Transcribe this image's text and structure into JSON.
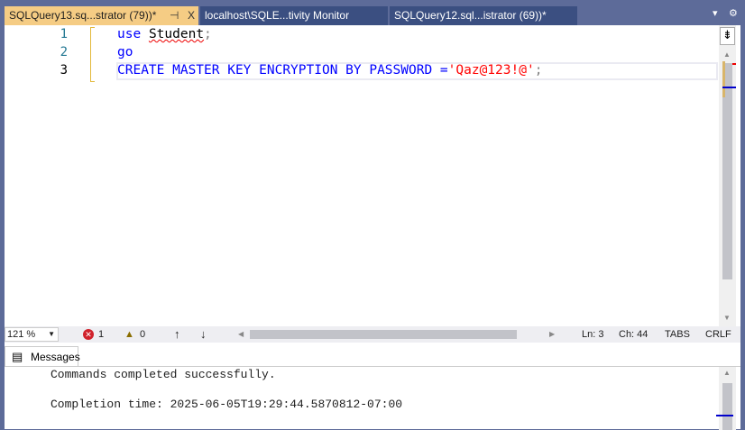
{
  "tabs": [
    {
      "label": "SQLQuery13.sq...strator (79))*",
      "active": true
    },
    {
      "label": "localhost\\SQLE...tivity Monitor",
      "active": false
    },
    {
      "label": "SQLQuery12.sql...istrator (69))*",
      "active": false
    }
  ],
  "tab_icons": {
    "pin": "⊣",
    "close": "X",
    "dropdown": "▾",
    "settings": "⚙"
  },
  "editor": {
    "line_numbers": [
      "1",
      "2",
      "3"
    ],
    "lines": [
      {
        "kw": "use",
        "ident": "Student",
        "punct": ";"
      },
      {
        "kw": "go"
      },
      {
        "kw": "CREATE MASTER KEY ENCRYPTION BY PASSWORD =",
        "str": "'Qaz@123!@'",
        "punct": ";"
      }
    ]
  },
  "status": {
    "zoom": "121 %",
    "errors": "1",
    "warnings": "0",
    "line": "Ln: 3",
    "col": "Ch: 44",
    "tabs": "TABS",
    "eol": "CRLF"
  },
  "messages": {
    "tab_label": "Messages",
    "lines": [
      "Commands completed successfully.",
      "Completion time: 2025-06-05T19:29:44.5870812-07:00"
    ]
  },
  "colors": {
    "keyword": "#0000ff",
    "string": "#ff0000",
    "active_tab": "#f5cc84",
    "frame": "#5d6b99"
  }
}
